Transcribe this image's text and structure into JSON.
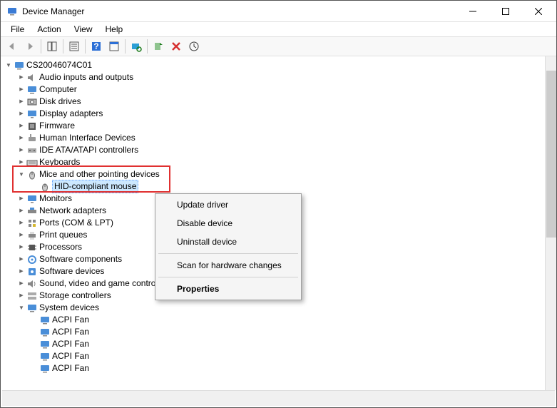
{
  "window": {
    "title": "Device Manager"
  },
  "menu": {
    "file": "File",
    "action": "Action",
    "view": "View",
    "help": "Help"
  },
  "root": {
    "name": "CS20046074C01"
  },
  "categories": [
    {
      "label": "Audio inputs and outputs",
      "icon": "audio"
    },
    {
      "label": "Computer",
      "icon": "computer"
    },
    {
      "label": "Disk drives",
      "icon": "disk"
    },
    {
      "label": "Display adapters",
      "icon": "display"
    },
    {
      "label": "Firmware",
      "icon": "firmware"
    },
    {
      "label": "Human Interface Devices",
      "icon": "hid"
    },
    {
      "label": "IDE ATA/ATAPI controllers",
      "icon": "ide"
    },
    {
      "label": "Keyboards",
      "icon": "keyboard"
    },
    {
      "label": "Mice and other pointing devices",
      "icon": "mouse",
      "expanded": true,
      "children": [
        {
          "label": "HID-compliant mouse",
          "icon": "mouse",
          "selected": true
        }
      ]
    },
    {
      "label": "Monitors",
      "icon": "monitor"
    },
    {
      "label": "Network adapters",
      "icon": "network"
    },
    {
      "label": "Ports (COM & LPT)",
      "icon": "ports"
    },
    {
      "label": "Print queues",
      "icon": "printer"
    },
    {
      "label": "Processors",
      "icon": "cpu"
    },
    {
      "label": "Software components",
      "icon": "softcomp"
    },
    {
      "label": "Software devices",
      "icon": "softdev"
    },
    {
      "label": "Sound, video and game controllers",
      "icon": "sound"
    },
    {
      "label": "Storage controllers",
      "icon": "storage"
    },
    {
      "label": "System devices",
      "icon": "system",
      "expanded": true,
      "children": [
        {
          "label": "ACPI Fan",
          "icon": "system"
        },
        {
          "label": "ACPI Fan",
          "icon": "system"
        },
        {
          "label": "ACPI Fan",
          "icon": "system"
        },
        {
          "label": "ACPI Fan",
          "icon": "system"
        },
        {
          "label": "ACPI Fan",
          "icon": "system"
        }
      ]
    }
  ],
  "context_menu": {
    "update": "Update driver",
    "disable": "Disable device",
    "uninstall": "Uninstall device",
    "scan": "Scan for hardware changes",
    "properties": "Properties"
  }
}
